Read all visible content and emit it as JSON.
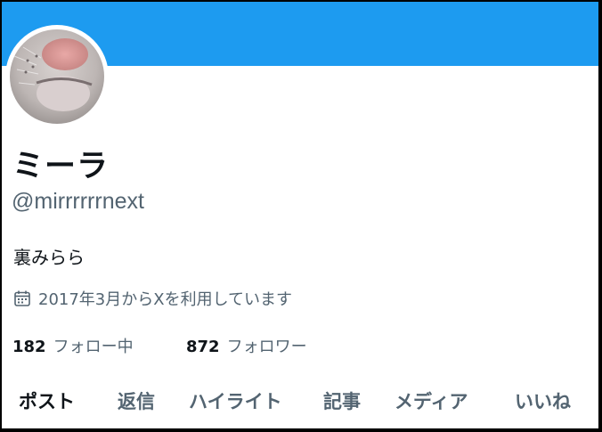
{
  "profile": {
    "display_name": "ミーラ",
    "handle": "@mirrrrrrnext",
    "bio": "裏みらら",
    "joined": "2017年3月からXを利用しています",
    "following_count": "182",
    "following_label": "フォロー中",
    "followers_count": "872",
    "followers_label": "フォロワー"
  },
  "tabs": [
    {
      "label": "ポスト",
      "active": true
    },
    {
      "label": "返信"
    },
    {
      "label": "ハイライト"
    },
    {
      "label": "記事"
    },
    {
      "label": "メディア"
    },
    {
      "label": "いいね"
    }
  ],
  "colors": {
    "banner": "#1d9bf0",
    "primary_text": "#0f1419",
    "secondary_text": "#536471"
  },
  "icons": {
    "joined": "calendar-icon"
  }
}
